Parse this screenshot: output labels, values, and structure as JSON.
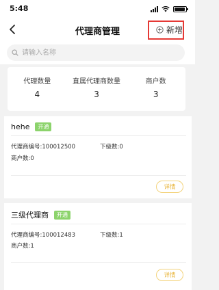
{
  "status_bar": {
    "time": "5:48"
  },
  "header": {
    "title": "代理商管理",
    "add_label": "新增"
  },
  "search": {
    "placeholder": "请输入名称"
  },
  "stats": [
    {
      "label": "代理数量",
      "value": "4"
    },
    {
      "label": "直属代理商数量",
      "value": "3"
    },
    {
      "label": "商户数",
      "value": "3"
    }
  ],
  "agents": [
    {
      "name": "hehe",
      "status": "开通",
      "code_label": "代理商编号:",
      "code": "100012500",
      "sub_label": "下级数:",
      "sub_count": "0",
      "merchant_label": "商户数:",
      "merchant_count": "0",
      "detail_label": "详情"
    },
    {
      "name": "三级代理商",
      "status": "开通",
      "code_label": "代理商编号:",
      "code": "100012483",
      "sub_label": "下级数:",
      "sub_count": "1",
      "merchant_label": "商户数:",
      "merchant_count": "1",
      "detail_label": "详情"
    }
  ]
}
